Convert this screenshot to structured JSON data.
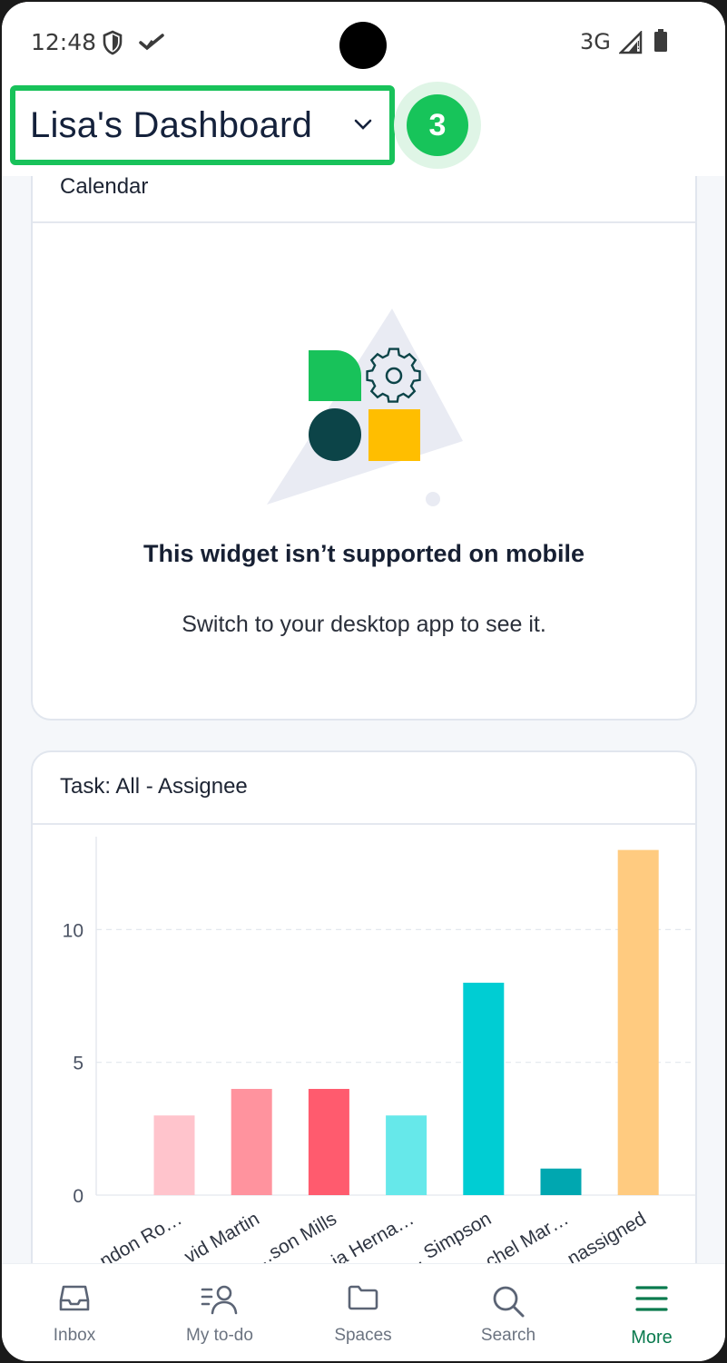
{
  "status_bar": {
    "time": "12:48",
    "network": "3G"
  },
  "header": {
    "title": "Lisa's Dashboard",
    "step_number": "3"
  },
  "calendar_card": {
    "title": "Calendar",
    "message_title": "This widget isn’t supported on mobile",
    "message_subtitle": "Switch to your desktop app to see it."
  },
  "task_card": {
    "title": "Task: All - Assignee"
  },
  "chart_data": {
    "type": "bar",
    "title": "",
    "xlabel": "",
    "ylabel": "",
    "categories": [
      "…ndon Ro…",
      "…vid Martin",
      "…son Mills",
      "…ia Herna…",
      "… Simpson",
      "…chel Mar…",
      "…nassigned"
    ],
    "values": [
      3,
      4,
      4,
      3,
      8,
      1,
      13
    ],
    "colors": [
      "#ffc4cc",
      "#ff939e",
      "#ff5b6e",
      "#66e8ea",
      "#00cdd3",
      "#00a7b0",
      "#ffcb80"
    ],
    "yticks": [
      0,
      5,
      10
    ],
    "ylim": [
      0,
      13.5
    ],
    "grid": true
  },
  "tabs": [
    {
      "label": "Inbox",
      "icon": "inbox-icon"
    },
    {
      "label": "My to-do",
      "icon": "my-todo-icon"
    },
    {
      "label": "Spaces",
      "icon": "folder-icon"
    },
    {
      "label": "Search",
      "icon": "search-icon"
    },
    {
      "label": "More",
      "icon": "menu-icon",
      "active": true
    }
  ],
  "colors": {
    "accent_green": "#18c25a",
    "active_tab": "#0a7a4e",
    "title_text": "#14213b"
  }
}
